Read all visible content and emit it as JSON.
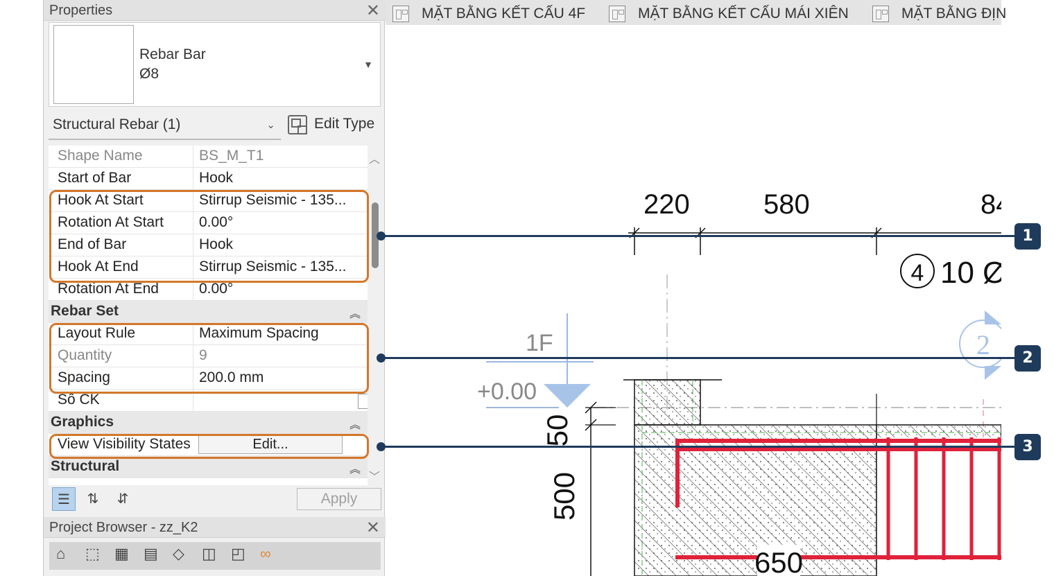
{
  "properties": {
    "title": "Properties",
    "type_name": "Rebar Bar",
    "type_size": "Ø8",
    "filter": "Structural Rebar (1)",
    "edit_type": "Edit Type",
    "rows": [
      {
        "key": "Shape Name",
        "value": "BS_M_T1",
        "dim": true
      },
      {
        "key": "Start of Bar",
        "value": "Hook"
      },
      {
        "key": "Hook At Start",
        "value": "Stirrup Seismic - 135..."
      },
      {
        "key": "Rotation At Start",
        "value": "0.00°"
      },
      {
        "key": "End of Bar",
        "value": "Hook"
      },
      {
        "key": "Hook At End",
        "value": "Stirrup Seismic - 135..."
      },
      {
        "key": "Rotation At End",
        "value": "0.00°"
      },
      {
        "section": "Rebar Set"
      },
      {
        "key": "Layout Rule",
        "value": "Maximum Spacing"
      },
      {
        "key": "Quantity",
        "value": "9",
        "dim": true
      },
      {
        "key": "Spacing",
        "value": "200.0 mm"
      },
      {
        "key": "Số CK",
        "value": "",
        "checkbox": true
      },
      {
        "section": "Graphics"
      },
      {
        "key": "View Visibility States",
        "button": "Edit..."
      },
      {
        "section": "Structural"
      }
    ],
    "apply": "Apply"
  },
  "project_browser": {
    "title": "Project Browser - zz_K2"
  },
  "tabs": [
    {
      "label": "MẶT BẰNG KẾT CẤU 4F"
    },
    {
      "label": "MẶT BẰNG KẾT CẤU MÁI XIÊN"
    },
    {
      "label": "MẶT BẰNG ĐỊN"
    }
  ],
  "drawing": {
    "dims_top": [
      "220",
      "580",
      "84"
    ],
    "level_name": "1F",
    "level_value": "+0.00",
    "dim_50": "50",
    "dim_500": "500",
    "dim_650": "650",
    "rebar_tag_circle": "4",
    "rebar_tag_text": "10 Ø",
    "section_mark": "2",
    "colors": {
      "rebar": "#e0223a",
      "hatch": "#555555",
      "leader": "#1f3b5c",
      "highlight": "#d4772a"
    }
  },
  "callouts": [
    "1",
    "2",
    "3"
  ]
}
